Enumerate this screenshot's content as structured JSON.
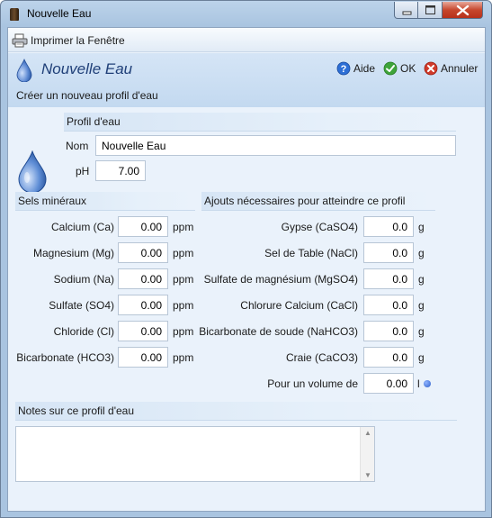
{
  "window": {
    "title": "Nouvelle Eau"
  },
  "toolbar": {
    "print_label": "Imprimer la Fenêtre"
  },
  "header": {
    "title": "Nouvelle Eau",
    "subtitle": "Créer un nouveau profil d'eau",
    "help_label": "Aide",
    "ok_label": "OK",
    "cancel_label": "Annuler"
  },
  "profile": {
    "section_title": "Profil d'eau",
    "name_label": "Nom",
    "name_value": "Nouvelle Eau",
    "ph_label": "pH",
    "ph_value": "7.00"
  },
  "minerals": {
    "section_title": "Sels minéraux",
    "unit": "ppm",
    "items": [
      {
        "label": "Calcium (Ca)",
        "value": "0.00"
      },
      {
        "label": "Magnesium (Mg)",
        "value": "0.00"
      },
      {
        "label": "Sodium (Na)",
        "value": "0.00"
      },
      {
        "label": "Sulfate (SO4)",
        "value": "0.00"
      },
      {
        "label": "Chloride (Cl)",
        "value": "0.00"
      },
      {
        "label": "Bicarbonate (HCO3)",
        "value": "0.00"
      }
    ]
  },
  "additions": {
    "section_title": "Ajouts nécessaires pour atteindre ce profil",
    "unit": "g",
    "items": [
      {
        "label": "Gypse (CaSO4)",
        "value": "0.0"
      },
      {
        "label": "Sel de Table (NaCl)",
        "value": "0.0"
      },
      {
        "label": "Sulfate de magnésium (MgSO4)",
        "value": "0.0"
      },
      {
        "label": "Chlorure  Calcium (CaCl)",
        "value": "0.0"
      },
      {
        "label": "Bicarbonate de soude (NaHCO3)",
        "value": "0.0"
      },
      {
        "label": "Craie (CaCO3)",
        "value": "0.0"
      }
    ],
    "volume_label": "Pour un volume de",
    "volume_value": "0.00",
    "volume_unit": "l"
  },
  "notes": {
    "section_title": "Notes sur ce profil d'eau",
    "value": ""
  },
  "colors": {
    "header_title": "#1f3f78",
    "drop": "#3f74c8",
    "help": "#2d6fd6",
    "ok": "#3ea43a",
    "cancel": "#d03a2a"
  }
}
